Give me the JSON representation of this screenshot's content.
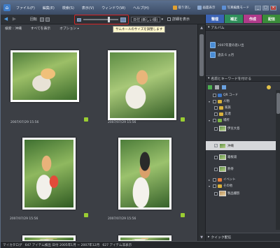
{
  "menubar": {
    "items": [
      "ファイル(F)",
      "編集(E)",
      "検索(S)",
      "表示(V)",
      "ウィンドウ(W)",
      "ヘルプ(H)"
    ],
    "undo": "取り消し",
    "display": "画面表示",
    "mode": "写真編集モード"
  },
  "toolbar": {
    "rotate": "回転",
    "sort_label": "日付 (新しい順)",
    "details_label": "詳細を表示",
    "tooltip": "サムネールのサイズを調整します"
  },
  "filterbar": {
    "search": "検索",
    "keyword": "沖縄",
    "show_all": "すべてを表示",
    "options": "オプション"
  },
  "photos": [
    {
      "date": "2007/07/29 15:56"
    },
    {
      "date": "2007/07/29 15:56"
    },
    {
      "date": "2007/07/29 15:56"
    },
    {
      "date": "2007/07/29 15:56"
    }
  ],
  "mode_tabs": {
    "organize": "整理",
    "fix": "補正",
    "create": "作成",
    "share": "配信"
  },
  "album_panel": {
    "title": "アルバム",
    "albums": [
      "2007年夏の思い出",
      "過去 6 ヵ月"
    ]
  },
  "keyword_panel": {
    "title": "名前とキーワードを付ける",
    "items": [
      {
        "label": "QR コード",
        "checked": false
      },
      {
        "label": "人物",
        "checked": false
      },
      {
        "label": "家族",
        "checked": false
      },
      {
        "label": "友達",
        "checked": false
      },
      {
        "label": "場所",
        "checked": false
      },
      {
        "label": "伊豆大島",
        "checked": false
      },
      {
        "label": "沖縄",
        "checked": true
      },
      {
        "label": "箱根湯",
        "checked": false
      },
      {
        "label": "熱帯",
        "checked": false
      },
      {
        "label": "イベント",
        "checked": false
      },
      {
        "label": "その他",
        "checked": false
      },
      {
        "label": "製品撮影",
        "checked": false
      }
    ]
  },
  "quickshare": {
    "title": "クイック配信"
  },
  "status": {
    "catalog": "マイカタログ",
    "text": "647 アイテム検出 日付 2005年1月 ~ 2007年12月",
    "count": "627 アイテム非表示"
  },
  "colors": {
    "organize": "#3b63b5",
    "fix": "#2f8f5b",
    "create": "#b03a8a",
    "share": "#3a8c3a",
    "highlight": "#d72424"
  }
}
